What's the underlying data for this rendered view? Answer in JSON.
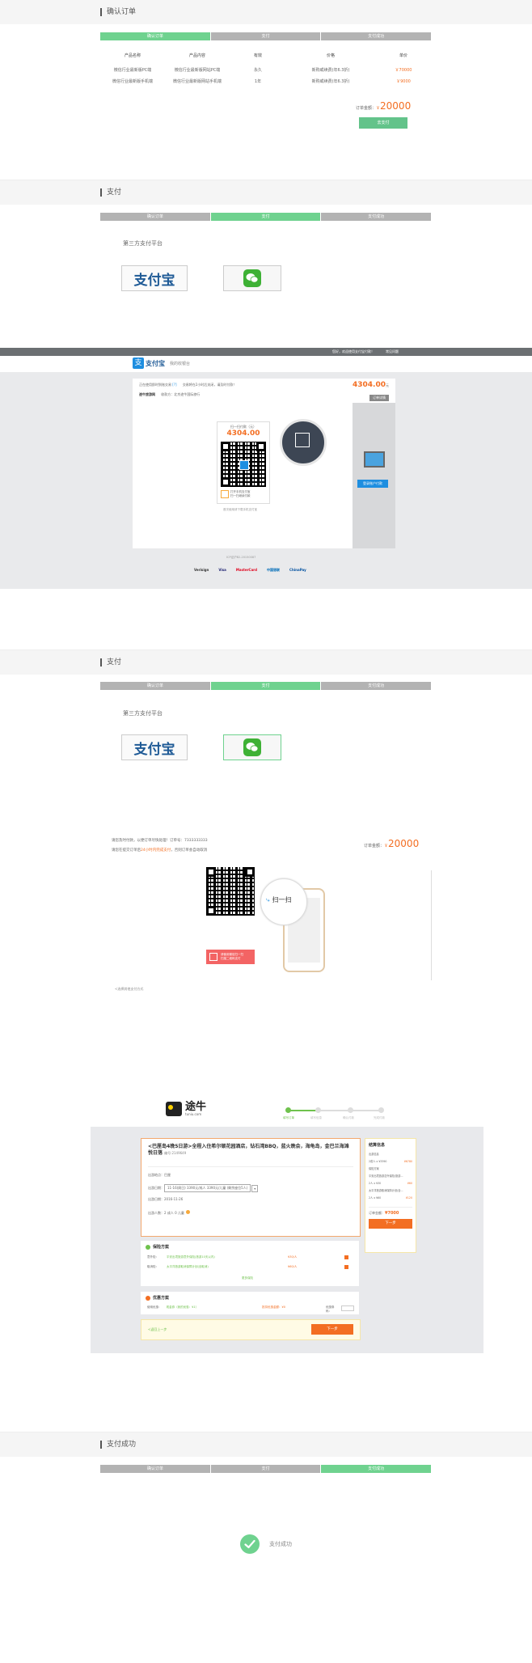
{
  "steps": [
    "确认订单",
    "支付",
    "支付成功"
  ],
  "s1": {
    "title": "确认订单",
    "headers": [
      "产品名称",
      "产品内容",
      "有效",
      "价格",
      "单价"
    ],
    "rows": [
      [
        "微信行业最新版PC端",
        "微信行业最新版网站PC端",
        "永久",
        "新购或续费(年6.3折)",
        "￥70000"
      ],
      [
        "微信行业最新版手机端",
        "微信行业最新版网站手机端",
        "1年",
        "新购或续费(年6.3折)",
        "￥9000"
      ]
    ],
    "total_label": "订单金额：",
    "total_currency": "￥",
    "total_value": "20000",
    "pay_button": "去支付"
  },
  "s2": {
    "title": "支付",
    "third_party_label": "第三方支付平台",
    "alipay_text": "支付宝"
  },
  "alipay_page": {
    "top_links": [
      "您好，欢迎使用支付宝付款！",
      "常见问题"
    ],
    "logo_text": "支付宝",
    "logo_sub": "我的收银台",
    "notice_line1": "正在使用即时到账交易",
    "notice_link": "[?]",
    "notice_line2": "交易将在2小时后关闭，请及时付款！",
    "merchant_label": "途牛旅游网",
    "merchant_info": "收款方：北京途牛国际旅行",
    "amount": "4304.00",
    "amount_unit": "元",
    "detail_btn": "订单详情",
    "scan_title": "扫一扫付款（元）",
    "scan_amount": "4304.00",
    "scan_hint1": "打开手机支付宝",
    "scan_hint2": "扫一扫继续付款",
    "tip_link": "首次使用请下载手机支付宝",
    "right_btn": "登录账户付款",
    "footer_text": "ICP证沪B2-20150087",
    "brands": [
      "Verisign",
      "Visa",
      "MasterCard",
      "中国银联",
      "ChinaPay"
    ]
  },
  "s3": {
    "title": "支付",
    "third_party_label": "第三方支付平台",
    "alipay_text": "支付宝"
  },
  "wechat_pay": {
    "line1": "请您及时付款，以便订单尽快处理！订单号：7333333333",
    "line2_a": "请您在提交订单后",
    "line2_b": "24小时内完成支付",
    "line2_c": "，否则订单会自动取消",
    "total_label": "订单金额：",
    "total_currency": "￥",
    "total_value": "20000",
    "scan_hint1": "请使用微信扫一扫",
    "scan_hint2": "扫描二维码支付",
    "phone_scan_text": "扫一扫",
    "other_methods": "<选择其他支付方式"
  },
  "tuniu": {
    "logo_text": "途牛",
    "logo_sub": "tuniu.com",
    "progress": [
      "填写订单",
      "填写信息",
      "确认付款",
      "完成付款"
    ],
    "product_title": "<巴厘岛4晚5日游>全程入住希尔顿花园酒店，钻石湾BBQ，蓝火晚会，海龟岛，金巴兰海滩\n悦日落",
    "product_code": "编号:2149649",
    "rows": [
      [
        "出游地点：",
        "巴厘"
      ],
      [
        "出游日期：",
        "11-16(周日) 3390元/成人 3390元/儿童 (剩余座位5人)"
      ],
      [
        "出游日期：",
        "2016-11-26"
      ],
      [
        "出游人数：",
        "2  成人    0  儿童"
      ]
    ],
    "insurance_title": "保险方案",
    "insurance_rows": [
      [
        "意外险：",
        "平安出境旅游意外保险(旅游10天以内)",
        "¥30/人"
      ],
      [
        "取消险：",
        "太平洋旅游取消保障计划(含取消)",
        "¥60/人"
      ]
    ],
    "insurance_more": "更多保险",
    "coupon_title": "优惠方案",
    "coupon_row": [
      "使用优惠：",
      "现金券（我的优惠：¥1）",
      "抵扣优惠金额：¥0",
      "优惠券码："
    ],
    "back_link": "<返回上一步",
    "next_button": "下一步",
    "side_title": "结算信息",
    "side_items": [
      [
        "出游信息",
        ""
      ],
      [
        "2成人 x ¥3390",
        "¥6780"
      ],
      [
        "保险方案",
        ""
      ],
      [
        "平安出境旅游意外保险(旅游...",
        ""
      ],
      [
        "2人 x ¥30",
        "¥60"
      ],
      [
        "太平洋旅游取消保障计划(含...",
        ""
      ],
      [
        "2人 x ¥60",
        "¥120"
      ]
    ],
    "side_total_label": "订单金额：",
    "side_total_value": "¥7000",
    "side_button": "下一步"
  },
  "s4": {
    "title": "支付成功",
    "success_text": "支付成功"
  },
  "colors": {
    "green": "#6fd28f",
    "orange": "#f36e22",
    "gray": "#b3b3b3",
    "alipay_blue": "#1e5a96"
  }
}
